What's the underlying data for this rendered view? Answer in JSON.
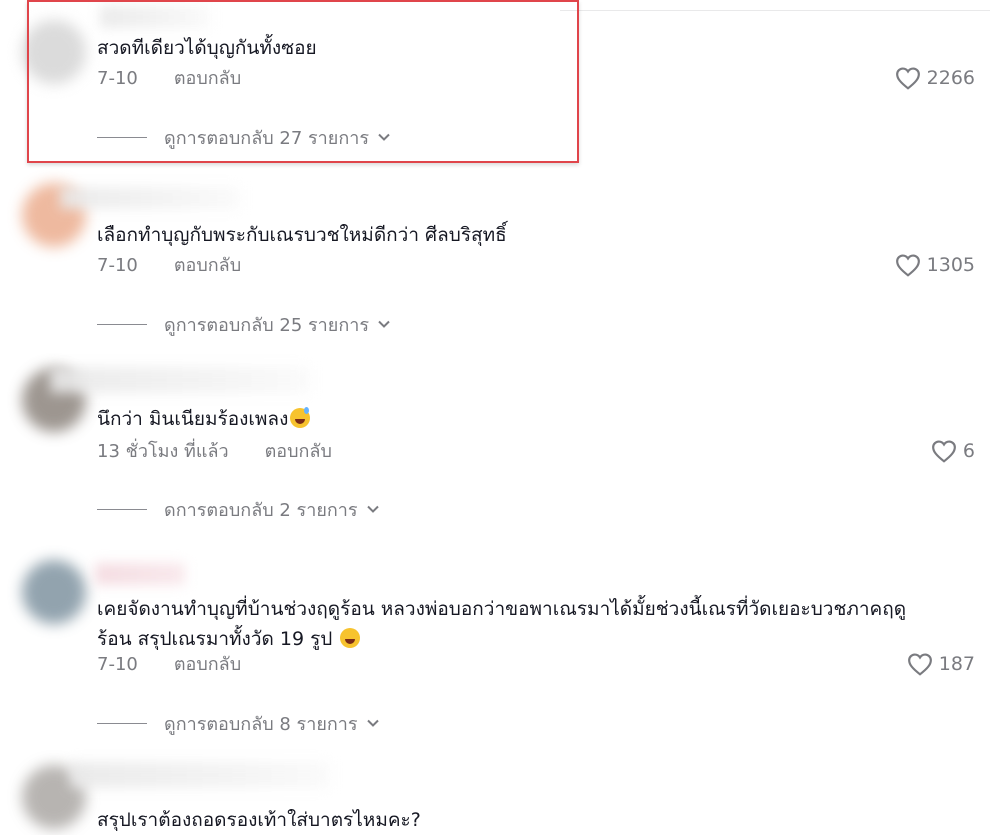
{
  "comments": [
    {
      "text": "สวดทีเดียวได้บุญกันทั้งซอย",
      "date": "7-10",
      "reply_label": "ตอบกลับ",
      "likes": "2266",
      "view_replies": "ดูการตอบกลับ 27 รายการ",
      "avatar_color": "#c9c9c9",
      "highlighted": true
    },
    {
      "text": "เลือกทำบุญกับพระกับเณรบวชใหม่ดีกว่า ศีลบริสุทธิ์",
      "date": "7-10",
      "reply_label": "ตอบกลับ",
      "likes": "1305",
      "view_replies": "ดูการตอบกลับ 25 รายการ",
      "avatar_color": "#e9a27f"
    },
    {
      "text": "นึกว่า มินเนียมร้องเพลง",
      "date": "13 ชั่วโมง ที่แล้ว",
      "reply_label": "ตอบกลับ",
      "likes": "6",
      "view_replies": "ดการตอบกลับ 2 รายการ",
      "avatar_color": "#7d746c",
      "emoji": "grinning-sweat-emoji"
    },
    {
      "text_line1": "เคยจัดงานทำบุญที่บ้านช่วงฤดูร้อน หลวงพ่อบอกว่าขอพาเณรมาได้มั้ยช่วงนี้เณรที่วัดเยอะบวชภาคฤดู",
      "text_line2": "ร้อน สรุปเณรมาทั้งวัด 19 รูป",
      "date": "7-10",
      "reply_label": "ตอบกลับ",
      "likes": "187",
      "view_replies": "ดูการตอบกลับ 8 รายการ",
      "avatar_color": "#6e8594",
      "emoji": "rolling-laughing-emoji"
    },
    {
      "text": "สรุปเราต้องถอดรองเท้าใส่บาตรไหมคะ?",
      "avatar_color": "#a09c98"
    }
  ],
  "colors": {
    "text": "#161823",
    "muted": "#7a7b80",
    "highlight_border": "#e0454b"
  }
}
